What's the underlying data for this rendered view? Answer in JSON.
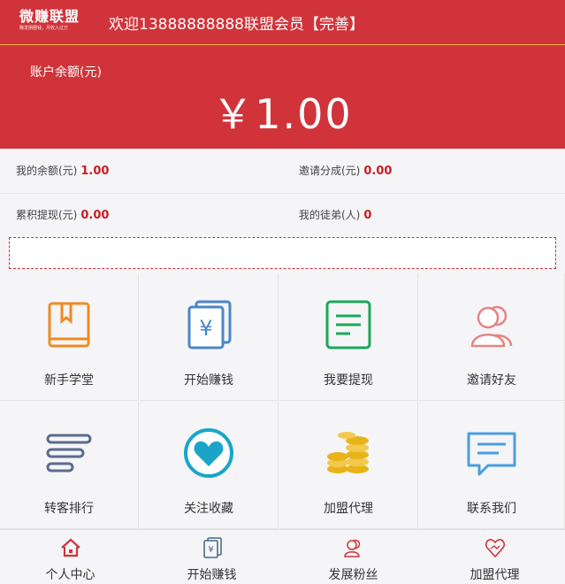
{
  "header": {
    "logo_title": "微赚联盟",
    "logo_sub": "赚发朋圈钱，月收入过万",
    "welcome": "欢迎13888888888联盟会员【完善】"
  },
  "balance": {
    "label": "账户余额(元)",
    "value": "￥1.00"
  },
  "stats": {
    "my_balance_label": "我的余额(元)",
    "my_balance_value": "1.00",
    "invite_share_label": "邀请分成(元)",
    "invite_share_value": "0.00",
    "total_withdraw_label": "累积提现(元)",
    "total_withdraw_value": "0.00",
    "my_apprentices_label": "我的徒弟(人)",
    "my_apprentices_value": "0"
  },
  "grid": {
    "novice": "新手学堂",
    "start_earning": "开始赚钱",
    "withdraw": "我要提现",
    "invite_friends": "邀请好友",
    "forward_rank": "转客排行",
    "follow_favorite": "关注收藏",
    "join_agent": "加盟代理",
    "contact_us": "联系我们"
  },
  "tabbar": {
    "personal": "个人中心",
    "start_earning": "开始赚钱",
    "grow_fans": "发展粉丝",
    "join_agent": "加盟代理"
  },
  "colors": {
    "brand_red": "#d0343a",
    "value_red": "#c81e25",
    "orange": "#f08a24",
    "blue": "#4a86c8",
    "green": "#1aa85a",
    "pink": "#e58484",
    "slate": "#5b6b8c",
    "teal": "#1aa5c8",
    "gold": "#e8b318",
    "sky": "#4a9ee0"
  },
  "icons": [
    "book-icon",
    "yen-card-icon",
    "document-icon",
    "users-icon",
    "list-icon",
    "heart-icon",
    "coins-icon",
    "chat-icon",
    "home-icon",
    "yen-card-icon",
    "fans-icon",
    "handshake-heart-icon"
  ]
}
